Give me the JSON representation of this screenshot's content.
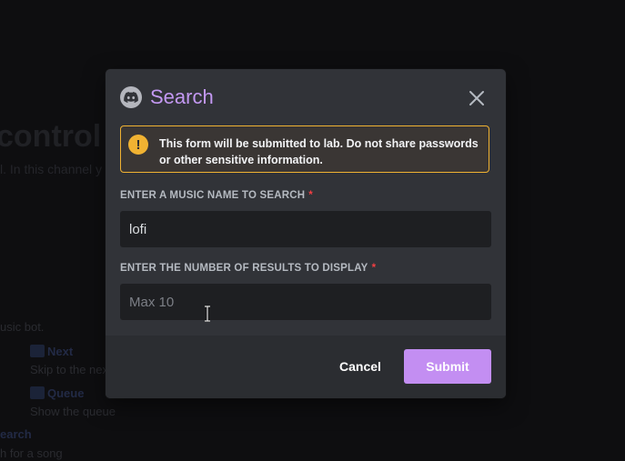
{
  "background": {
    "title_fragment": "control",
    "subtitle_fragment": "l. In this channel y",
    "music_bot_text": "usic bot.",
    "commands": [
      {
        "name": "Next",
        "description": "Skip to the nex"
      },
      {
        "name": "Queue",
        "description": "Show the queue"
      }
    ],
    "search_cmd_fragment": "earch",
    "search_desc_fragment": "h for a song"
  },
  "modal": {
    "title": "Search",
    "app_icon": "discord-logo-icon",
    "close_icon": "close-icon",
    "warning": {
      "text_before": "This form will be submitted to ",
      "app_name": "lab",
      "text_after": ". Do not share passwords or other sensitive information.",
      "icon": "exclamation-icon",
      "color": "#f0b232"
    },
    "fields": [
      {
        "label": "ENTER A MUSIC NAME TO SEARCH",
        "required_mark": "*",
        "value": "lofi",
        "placeholder": ""
      },
      {
        "label": "ENTER THE NUMBER OF RESULTS TO DISPLAY",
        "required_mark": "*",
        "value": "",
        "placeholder": "Max 10"
      }
    ],
    "cancel_label": "Cancel",
    "submit_label": "Submit"
  },
  "colors": {
    "accent": "#c38ef2",
    "title": "#c398f2",
    "required": "#f23f43"
  }
}
